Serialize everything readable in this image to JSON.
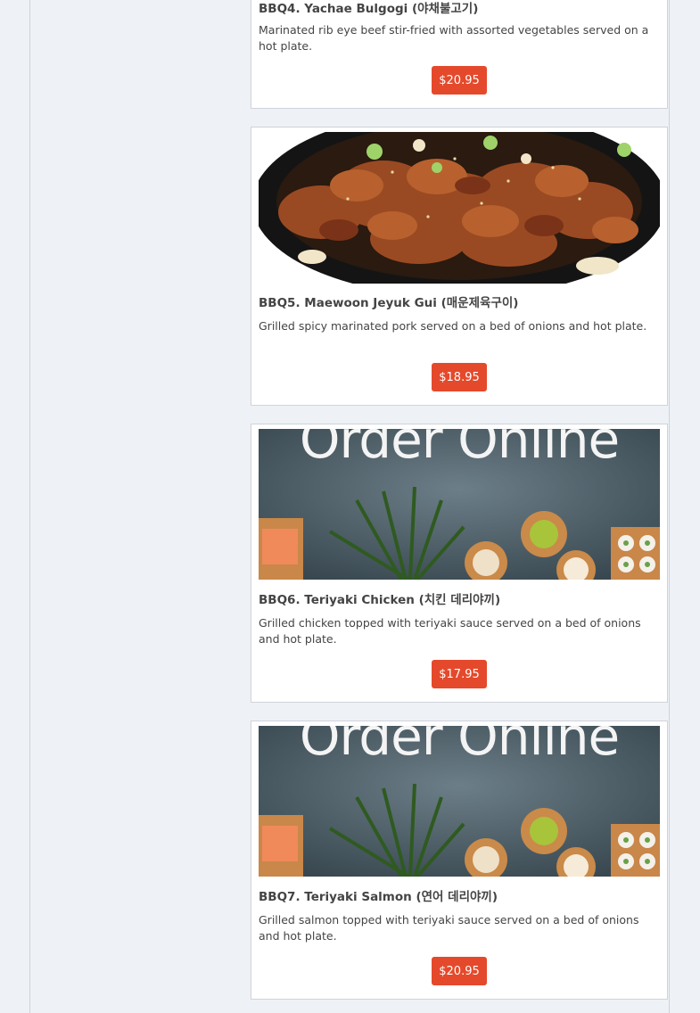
{
  "colors": {
    "price_button": "#e5492b",
    "card_border": "#cfd4da"
  },
  "menu_items": [
    {
      "code_title": "BBQ4. Yachae Bulgogi (야채불고기)",
      "description": "Marinated rib eye beef stir-fried with assorted vegetables served on a hot plate.",
      "price": "$20.95",
      "image": "none"
    },
    {
      "code_title": "BBQ5. Maewoon Jeyuk Gui (매운제육구이)",
      "description": "Grilled spicy marinated pork served on a bed of onions and hot plate.",
      "price": "$18.95",
      "image": "spicy-pork-photo"
    },
    {
      "code_title": "BBQ6. Teriyaki Chicken (치킨 데리야끼)",
      "description": "Grilled chicken topped with teriyaki sauce served on a bed of onions and hot plate.",
      "price": "$17.95",
      "image": "order-online-placeholder",
      "image_text": "Order Online"
    },
    {
      "code_title": "BBQ7. Teriyaki Salmon (연어 데리야끼)",
      "description": "Grilled salmon topped with teriyaki sauce served on a bed of onions and hot plate.",
      "price": "$20.95",
      "image": "order-online-placeholder",
      "image_text": "Order Online"
    }
  ]
}
